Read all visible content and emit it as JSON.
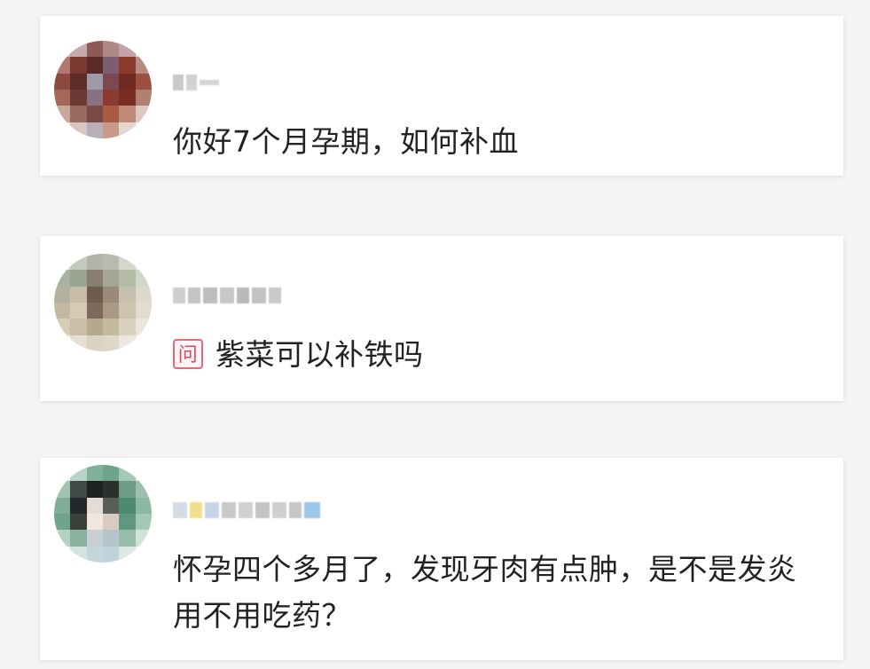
{
  "colors": {
    "background": "#f5f5f5",
    "card": "#ffffff",
    "text": "#222222",
    "question_badge": "#e8677a"
  },
  "comments": [
    {
      "avatar_icon": "pixelated-user-avatar-1",
      "username_obscured": true,
      "has_question_badge": false,
      "text": "你好7个月孕期，如何补血"
    },
    {
      "avatar_icon": "pixelated-user-avatar-2",
      "username_obscured": true,
      "has_question_badge": true,
      "badge_label": "问",
      "text": "紫菜可以补铁吗"
    },
    {
      "avatar_icon": "pixelated-user-avatar-3",
      "username_obscured": true,
      "has_question_badge": false,
      "text": "怀孕四个多月了，发现牙肉有点肿，是不是发炎用不用吃药？"
    }
  ]
}
